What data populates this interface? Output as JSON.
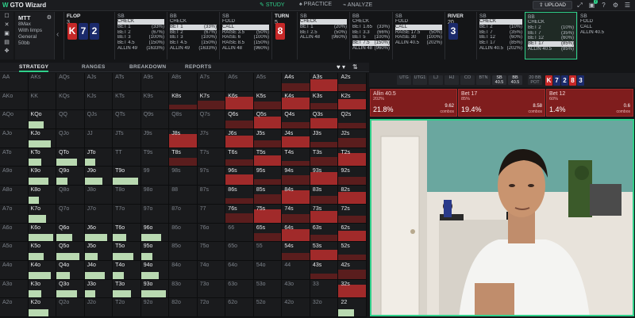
{
  "app": {
    "logo": "W",
    "title": "GTO Wizard"
  },
  "nav": {
    "study": "STUDY",
    "practice": "PRACTICE",
    "analyze": "ANALYZE",
    "upload": "UPLOAD",
    "badge": "7"
  },
  "sidebar_buttons": [
    "☐",
    "✕",
    "▣",
    "▤",
    "✥"
  ],
  "game": {
    "title": "MTT",
    "rows": [
      "8Max",
      "With limps",
      "General",
      "50bb"
    ]
  },
  "colors": {
    "accent": "#2fd08a",
    "raise": "#a12a2a",
    "check": "#b9d9b1",
    "hearts": "#c62828",
    "spades": "#1b2a6b",
    "dark_red": "#7f1d1d"
  },
  "street": [
    {
      "type": "board",
      "label": "FLOP",
      "num": "3",
      "cards": [
        {
          "r": "K",
          "c": "hearts"
        },
        {
          "r": "7",
          "c": "spades"
        },
        {
          "r": "2",
          "c": "spades"
        }
      ]
    },
    {
      "type": "actions",
      "pos": "SB",
      "acts": [
        {
          "a": "CHECK",
          "p": "",
          "sel": true
        },
        {
          "a": "BET 1",
          "p": "(33%)"
        },
        {
          "a": "BET 2",
          "p": "(67%)"
        },
        {
          "a": "BET 3",
          "p": "(100%)"
        },
        {
          "a": "BET 4.5",
          "p": "(150%)"
        },
        {
          "a": "ALLIN 49",
          "p": "(1633%)"
        }
      ]
    },
    {
      "type": "actions",
      "pos": "BB",
      "acts": [
        {
          "a": "CHECK",
          "p": ""
        },
        {
          "a": "BET 1",
          "p": "(33%)",
          "sel": true
        },
        {
          "a": "BET 2",
          "p": "(67%)"
        },
        {
          "a": "BET 3",
          "p": "(100%)"
        },
        {
          "a": "BET 4.5",
          "p": "(150%)"
        },
        {
          "a": "ALLIN 49",
          "p": "(1633%)"
        }
      ]
    },
    {
      "type": "actions",
      "pos": "SB",
      "acts": [
        {
          "a": "FOLD",
          "p": ""
        },
        {
          "a": "CALL",
          "p": "",
          "sel": true
        },
        {
          "a": "RAISE 3.5",
          "p": "(50%)"
        },
        {
          "a": "RAISE 6",
          "p": "(100%)"
        },
        {
          "a": "RAISE 8.5",
          "p": "(150%)"
        },
        {
          "a": "ALLIN 48",
          "p": "(960%)"
        }
      ]
    },
    {
      "type": "board",
      "label": "TURN",
      "num": "5",
      "cards": [
        {
          "r": "8",
          "c": "hearts"
        }
      ]
    },
    {
      "type": "actions",
      "pos": "SB",
      "acts": [
        {
          "a": "CHECK",
          "p": "",
          "sel": true
        },
        {
          "a": "BET 1",
          "p": "(20%)"
        },
        {
          "a": "BET 2.5",
          "p": "(50%)"
        },
        {
          "a": "ALLIN 48",
          "p": "(960%)"
        }
      ]
    },
    {
      "type": "actions",
      "pos": "BB",
      "acts": [
        {
          "a": "CHECK",
          "p": ""
        },
        {
          "a": "BET 1.65",
          "p": "(33%)"
        },
        {
          "a": "BET 3.3",
          "p": "(66%)"
        },
        {
          "a": "BET 5",
          "p": "(100%)"
        },
        {
          "a": "BET 7.5",
          "p": "(150%)",
          "sel": true
        },
        {
          "a": "ALLIN 48",
          "p": "(960%)"
        }
      ]
    },
    {
      "type": "actions",
      "pos": "SB",
      "acts": [
        {
          "a": "FOLD",
          "p": ""
        },
        {
          "a": "CALL",
          "p": "",
          "sel": true
        },
        {
          "a": "RAISE 17.5",
          "p": "(50%)"
        },
        {
          "a": "RAISE 30",
          "p": "(100%)"
        },
        {
          "a": "ALLIN 40.5",
          "p": "(202%)"
        }
      ]
    },
    {
      "type": "board",
      "label": "RIVER",
      "num": "20",
      "cards": [
        {
          "r": "3",
          "c": "spades"
        }
      ]
    },
    {
      "type": "actions",
      "pos": "SB",
      "acts": [
        {
          "a": "CHECK",
          "p": "",
          "sel": true
        },
        {
          "a": "BET 2",
          "p": "(10%)"
        },
        {
          "a": "BET 7",
          "p": "(35%)"
        },
        {
          "a": "BET 12",
          "p": "(60%)"
        },
        {
          "a": "BET 17",
          "p": "(85%)"
        },
        {
          "a": "ALLIN 40.5",
          "p": "(202%)"
        }
      ]
    },
    {
      "type": "actions",
      "pos": "BB",
      "highlight": true,
      "acts": [
        {
          "a": "CHECK",
          "p": ""
        },
        {
          "a": "BET 2",
          "p": "(10%)"
        },
        {
          "a": "BET 7",
          "p": "(35%)"
        },
        {
          "a": "BET 12",
          "p": "(60%)"
        },
        {
          "a": "BET 17",
          "p": "(85%)",
          "sel": true
        },
        {
          "a": "ALLIN 40.5",
          "p": "(85%)"
        }
      ]
    },
    {
      "type": "actions",
      "pos": "SB",
      "acts": [
        {
          "a": "FOLD",
          "p": ""
        },
        {
          "a": "CALL",
          "p": ""
        },
        {
          "a": "ALLIN 40.5",
          "p": ""
        }
      ]
    }
  ],
  "subtabs": {
    "strategy": "STRATEGY",
    "ranges": "RANGES",
    "breakdown": "BREAKDOWN",
    "reports": "REPORTS"
  },
  "filters": [
    {
      "l": "UTG",
      "v": ""
    },
    {
      "l": "UTG1",
      "v": ""
    },
    {
      "l": "LJ",
      "v": ""
    },
    {
      "l": "HJ",
      "v": ""
    },
    {
      "l": "CO",
      "v": ""
    },
    {
      "l": "BTN",
      "v": ""
    },
    {
      "l": "SB",
      "v": "40.5"
    },
    {
      "l": "BB",
      "v": "40.5"
    }
  ],
  "pot": {
    "label": "20 BB",
    "sub": "POT"
  },
  "pot_cards": [
    {
      "r": "K",
      "c": "hearts"
    },
    {
      "r": "7",
      "c": "spades"
    },
    {
      "r": "2",
      "c": "spades"
    },
    {
      "r": "8",
      "c": "hearts"
    },
    {
      "r": "3",
      "c": "spades"
    }
  ],
  "summary": [
    {
      "name": "Allin 40.5",
      "frac": "202%",
      "pct": "21.8%",
      "combos": "9.62",
      "clabel": "combos"
    },
    {
      "name": "Bet 17",
      "frac": "85%",
      "pct": "19.4%",
      "combos": "8.58",
      "clabel": "combos"
    },
    {
      "name": "Bet 12",
      "frac": "60%",
      "pct": "1.4%",
      "combos": "0.6",
      "clabel": "combos"
    }
  ],
  "grid": {
    "ranks": [
      "A",
      "K",
      "Q",
      "J",
      "T",
      "9",
      "8",
      "7",
      "6",
      "5",
      "4",
      "3",
      "2"
    ],
    "hot": [
      "A4s",
      "A3s",
      "A2s",
      "K8s",
      "K7s",
      "K6s",
      "K5s",
      "K4s",
      "K3s",
      "K2s",
      "KQo",
      "Q6s",
      "Q5s",
      "Q4s",
      "Q3s",
      "Q2s",
      "KJo",
      "J8s",
      "J6s",
      "J5s",
      "J4s",
      "J3s",
      "J2s",
      "KTo",
      "QTo",
      "JTo",
      "T8s",
      "T6s",
      "T5s",
      "T4s",
      "T3s",
      "T2s",
      "K9o",
      "Q9o",
      "J9o",
      "T9o",
      "96s",
      "95s",
      "94s",
      "93s",
      "92s",
      "K8o",
      "86s",
      "85s",
      "84s",
      "83s",
      "82s",
      "K7o",
      "76s",
      "75s",
      "74s",
      "73s",
      "72s",
      "K6o",
      "Q6o",
      "J6o",
      "T6o",
      "96o",
      "65s",
      "64s",
      "63s",
      "62s",
      "K5o",
      "Q5o",
      "J5o",
      "T5o",
      "95o",
      "54s",
      "53s",
      "52s",
      "K4o",
      "Q4o",
      "J4o",
      "T4o",
      "94o",
      "43s",
      "42s",
      "K3o",
      "Q3o",
      "J3o",
      "T3o",
      "93o",
      "32s",
      "K2o",
      "22"
    ]
  }
}
